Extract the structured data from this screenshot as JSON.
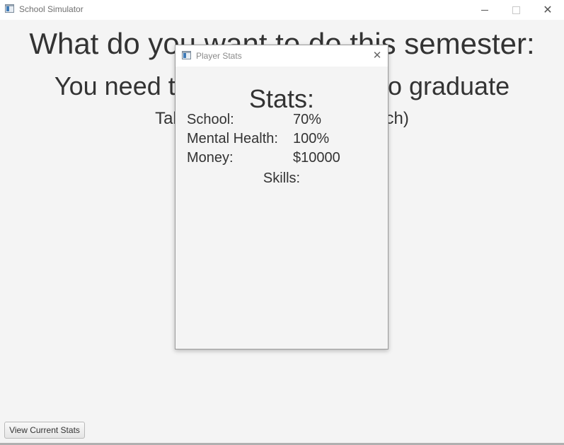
{
  "window": {
    "title": "School Simulator",
    "icon": "java-app-icon"
  },
  "main": {
    "heading": "What do you want to do this semester:",
    "subheading": "You need to do the following to graduate",
    "instruction": "Take courses (several skills each)",
    "view_stats_button": "View Current Stats"
  },
  "dialog": {
    "title": "Player Stats",
    "icon": "java-app-icon",
    "stats_title": "Stats:",
    "stats": [
      {
        "label": "School:",
        "value": "70%"
      },
      {
        "label": "Mental Health:",
        "value": "100%"
      },
      {
        "label": "Money:",
        "value": "$10000"
      }
    ],
    "skills_label": "Skills:"
  }
}
